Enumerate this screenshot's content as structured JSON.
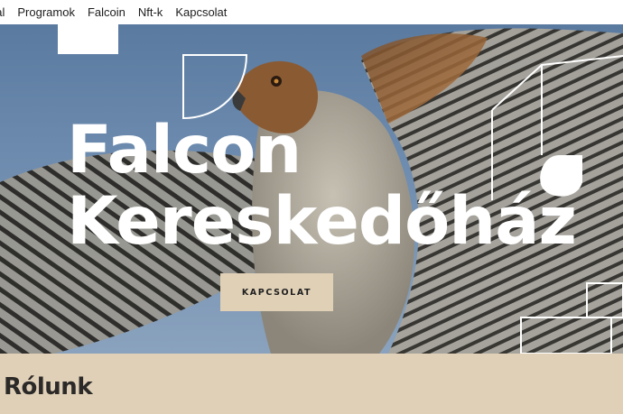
{
  "nav": {
    "items": [
      {
        "label": "dal"
      },
      {
        "label": "Programok"
      },
      {
        "label": "Falcoin"
      },
      {
        "label": "Nft-k"
      },
      {
        "label": "Kapcsolat"
      }
    ]
  },
  "hero": {
    "title_line1": "Falcon",
    "title_line2": "Kereskedőház",
    "cta_label": "KAPCSOLAT"
  },
  "about": {
    "title": "Rólunk"
  },
  "colors": {
    "accent_beige": "#dfd0b6",
    "sky": "#6d8bae",
    "text_dark": "#1d1d1d"
  }
}
